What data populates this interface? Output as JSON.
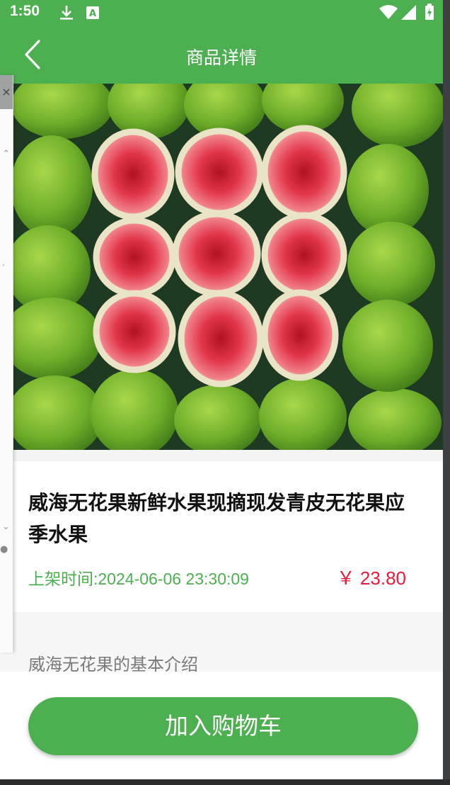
{
  "status_bar": {
    "time": "1:50",
    "icons": [
      "download-icon",
      "app-notification-icon",
      "wifi-icon",
      "cellular-signal-icon",
      "battery-icon"
    ]
  },
  "app_bar": {
    "title": "商品详情",
    "back_icon": "back-arrow-icon"
  },
  "product": {
    "image_subject": "halved green figs with red interior on leaves",
    "title": "威海无花果新鲜水果现摘现发青皮无花果应季水果",
    "listed_time": "上架时间:2024-06-06 23:30:09",
    "price": "￥ 23.80"
  },
  "intro": {
    "heading": "威海无花果的基本介绍"
  },
  "actions": {
    "add_to_cart_label": "加入购物车"
  },
  "colors": {
    "primary": "#4caf50",
    "price": "#e8193c",
    "text": "#111111",
    "muted": "#7a7a7a"
  }
}
